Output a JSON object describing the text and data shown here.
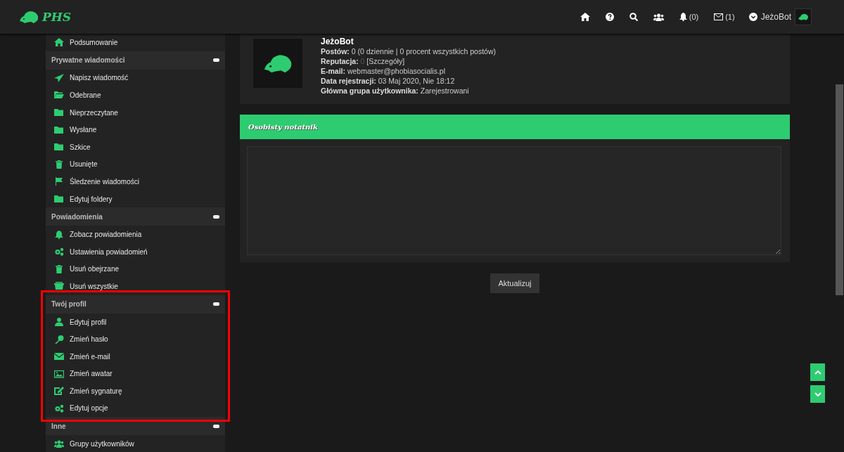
{
  "header": {
    "logo": "PHS",
    "nav": [
      {
        "kind": "home"
      },
      {
        "kind": "help"
      },
      {
        "kind": "search"
      },
      {
        "kind": "members"
      },
      {
        "kind": "notifications",
        "count": "(0)"
      },
      {
        "kind": "messages",
        "count": "(1)"
      }
    ],
    "user": "JeżoBot"
  },
  "sidebar": {
    "top_item": "Podsumowanie",
    "sections": [
      {
        "title": "Prywatne wiadomości",
        "items": [
          "Napisz wiadomość",
          "Odebrane",
          "Nieprzeczytane",
          "Wysłane",
          "Szkice",
          "Usunięte",
          "Śledzenie wiadomości",
          "Edytuj foldery"
        ]
      },
      {
        "title": "Powiadomienia",
        "items": [
          "Zobacz powiadomienia",
          "Ustawienia powiadomień",
          "Usuń obejrzane",
          "Usuń wszystkie"
        ]
      },
      {
        "title": "Twój profil",
        "highlighted": true,
        "items": [
          "Edytuj profil",
          "Zmień hasło",
          "Zmień e-mail",
          "Zmień awatar",
          "Zmień sygnaturę",
          "Edytuj opcje"
        ]
      },
      {
        "title": "Inne",
        "items": [
          "Grupy użytkowników"
        ]
      }
    ]
  },
  "profile": {
    "name": "JeżoBot",
    "lines": [
      {
        "label": "Postów:",
        "value": "0 (0 dziennie | 0 procent wszystkich postów)"
      },
      {
        "label": "Reputacja:",
        "muted": "0",
        "value": "[Szczegóły]"
      },
      {
        "label": "E-mail:",
        "value": "webmaster@phobiasocialis.pl"
      },
      {
        "label": "Data rejestracji:",
        "value": "03 Maj 2020, Nie 18:12"
      },
      {
        "label": "Główna grupa użytkownika:",
        "value": "Zarejestrowani"
      }
    ]
  },
  "notepad": {
    "title": "Osobisty notatnik",
    "button": "Aktualizuj"
  }
}
